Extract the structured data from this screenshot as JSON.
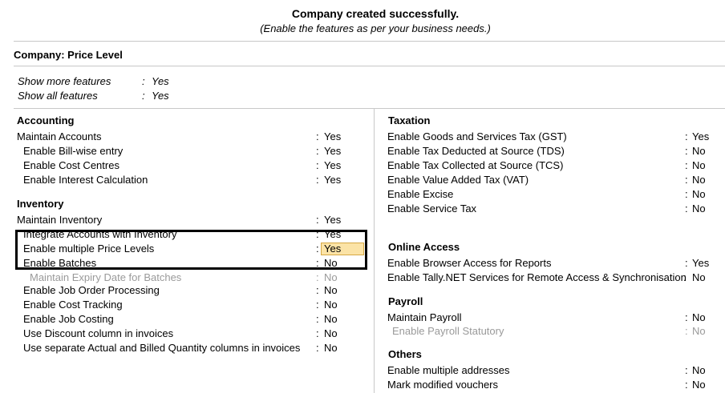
{
  "banner": {
    "title": "Company created successfully.",
    "subtitle": "(Enable the features as per your business needs.)"
  },
  "company_title": "Company: Price Level",
  "top_options": [
    {
      "label": "Show more features",
      "value": "Yes"
    },
    {
      "label": "Show all features",
      "value": "Yes"
    }
  ],
  "accounting": {
    "heading": "Accounting",
    "items": [
      {
        "label": "Maintain Accounts",
        "value": "Yes"
      },
      {
        "label": "Enable Bill-wise entry",
        "value": "Yes"
      },
      {
        "label": "Enable Cost Centres",
        "value": "Yes"
      },
      {
        "label": "Enable Interest Calculation",
        "value": "Yes"
      }
    ]
  },
  "inventory": {
    "heading": "Inventory",
    "items": [
      {
        "label": "Maintain Inventory",
        "value": "Yes"
      },
      {
        "label": "Integrate Accounts with Inventory",
        "value": "Yes"
      },
      {
        "label": "Enable multiple Price Levels",
        "value": "Yes"
      },
      {
        "label": "Enable Batches",
        "value": "No"
      },
      {
        "label": "Maintain Expiry Date for Batches",
        "value": "No"
      },
      {
        "label": "Enable Job Order Processing",
        "value": "No"
      },
      {
        "label": "Enable Cost Tracking",
        "value": "No"
      },
      {
        "label": "Enable Job Costing",
        "value": "No"
      },
      {
        "label": "Use Discount column in invoices",
        "value": "No"
      },
      {
        "label": "Use separate Actual and Billed Quantity columns in invoices",
        "value": "No"
      }
    ]
  },
  "taxation": {
    "heading": "Taxation",
    "items": [
      {
        "label": "Enable Goods and Services Tax (GST)",
        "value": "Yes"
      },
      {
        "label": "Enable Tax Deducted at Source (TDS)",
        "value": "No"
      },
      {
        "label": "Enable Tax Collected at Source (TCS)",
        "value": "No"
      },
      {
        "label": "Enable Value Added Tax (VAT)",
        "value": "No"
      },
      {
        "label": "Enable Excise",
        "value": "No"
      },
      {
        "label": "Enable Service Tax",
        "value": "No"
      }
    ]
  },
  "online_access": {
    "heading": "Online Access",
    "items": [
      {
        "label": "Enable Browser Access for Reports",
        "value": "Yes"
      },
      {
        "label": "Enable Tally.NET Services for Remote Access & Synchronisation",
        "value": "No"
      }
    ]
  },
  "payroll": {
    "heading": "Payroll",
    "items": [
      {
        "label": "Maintain Payroll",
        "value": "No"
      },
      {
        "label": "Enable Payroll Statutory",
        "value": "No"
      }
    ]
  },
  "others": {
    "heading": "Others",
    "items": [
      {
        "label": "Enable multiple addresses",
        "value": "No"
      },
      {
        "label": "Mark modified vouchers",
        "value": "No"
      }
    ]
  },
  "colon": ":"
}
